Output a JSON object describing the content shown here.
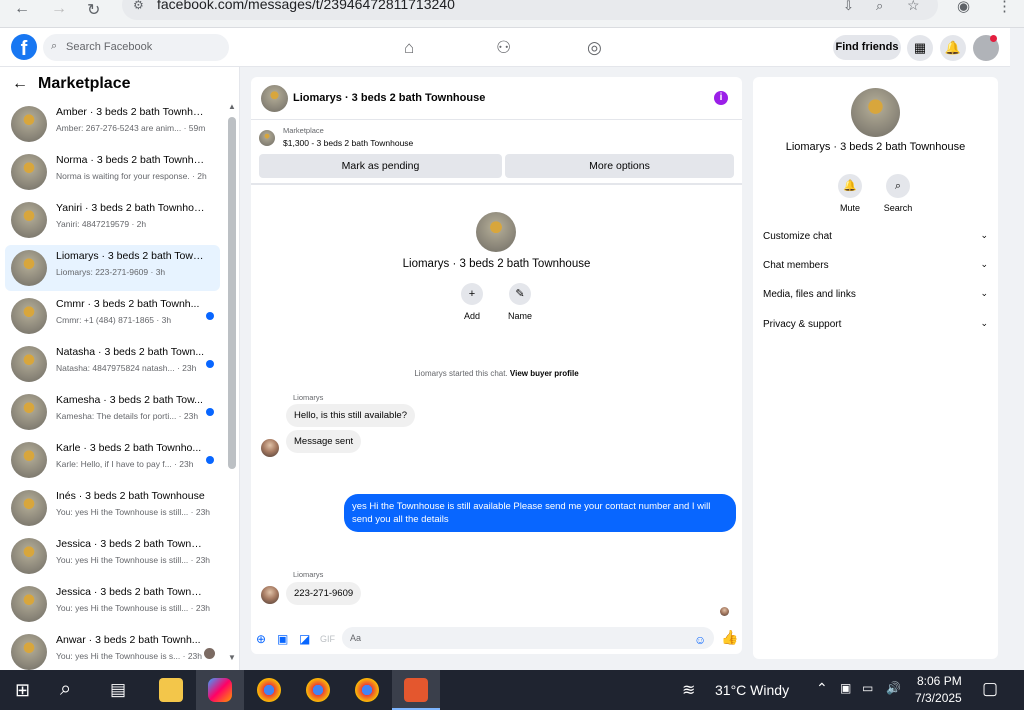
{
  "browser": {
    "url": "facebook.com/messages/t/23946472811713240"
  },
  "facebook": {
    "search_placeholder": "Search Facebook",
    "find_friends": "Find friends"
  },
  "sidebar": {
    "title": "Marketplace",
    "conversations": [
      {
        "title": "Amber · 3 beds 2 bath Townho...",
        "snippet": "Amber: 267-276-5243 are anim... · 59m",
        "unread": false
      },
      {
        "title": "Norma · 3 beds 2 bath Townho...",
        "snippet": "Norma is waiting for your response. · 2h",
        "unread": false
      },
      {
        "title": "Yaniri · 3 beds 2 bath Townhouse",
        "snippet": "Yaniri: 4847219579 · 2h",
        "unread": false
      },
      {
        "title": "Liomarys · 3 beds 2 bath Town...",
        "snippet": "Liomarys: 223-271-9609 · 3h",
        "unread": false,
        "active": true
      },
      {
        "title": "Cmmr · 3 beds 2 bath Townh...",
        "snippet": "Cmmr: +1 (484) 871-1865 · 3h",
        "unread": true
      },
      {
        "title": "Natasha · 3 beds 2 bath Town...",
        "snippet": "Natasha: 4847975824 natash... · 23h",
        "unread": true
      },
      {
        "title": "Kamesha · 3 beds 2 bath Tow...",
        "snippet": "Kamesha: The details for porti... · 23h",
        "unread": true
      },
      {
        "title": "Karle · 3 beds 2 bath Townho...",
        "snippet": "Karle: Hello, if I have to pay f... · 23h",
        "unread": true
      },
      {
        "title": "Inés · 3 beds 2 bath Townhouse",
        "snippet": "You: yes Hi the Townhouse is still... · 23h",
        "unread": false
      },
      {
        "title": "Jessica · 3 beds 2 bath Townho...",
        "snippet": "You: yes Hi the Townhouse is still... · 23h",
        "unread": false
      },
      {
        "title": "Jessica · 3 beds 2 bath Townho...",
        "snippet": "You: yes Hi the Townhouse is still... · 23h",
        "unread": false
      },
      {
        "title": "Anwar · 3 beds 2 bath Townh...",
        "snippet": "You: yes Hi the Townhouse is s... · 23h",
        "unread": false
      }
    ]
  },
  "chat": {
    "title": "Liomarys · 3 beds 2 bath Townhouse",
    "marketplace_label": "Marketplace",
    "listing": "$1,300 - 3 beds 2 bath Townhouse",
    "mark_pending": "Mark as pending",
    "more_options": "More options",
    "center_name": "Liomarys · 3 beds 2 bath Townhouse",
    "add_label": "Add",
    "name_label": "Name",
    "system_text": "Liomarys started this chat.",
    "view_profile": "View buyer profile",
    "sender1": "Liomarys",
    "msg1": "Hello, is this still available?",
    "msg2": "Message sent",
    "my_msg": "yes Hi the Townhouse is still available Please send me your contact number and I will send you all the details",
    "sender2": "Liomarys",
    "msg3": "223-271-9609",
    "composer_placeholder": "Aa"
  },
  "details": {
    "name": "Liomarys · 3 beds 2 bath Townhouse",
    "mute": "Mute",
    "search": "Search",
    "sections": [
      "Customize chat",
      "Chat members",
      "Media, files and links",
      "Privacy & support"
    ]
  },
  "taskbar": {
    "weather": "31°C  Windy",
    "time": "8:06 PM",
    "date": "7/3/2025"
  }
}
